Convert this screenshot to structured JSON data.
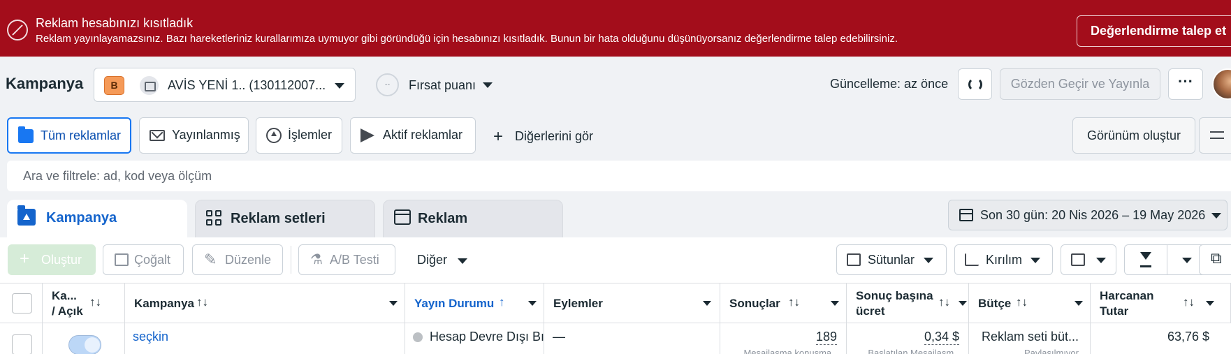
{
  "banner": {
    "title": "Reklam hesabınızı kısıtladık",
    "text": "Reklam yayınlayamazsınız. Bazı hareketleriniz kurallarımıza uymuyor gibi göründüğü için hesabınızı kısıtladık. Bunun bir hata olduğunu düşünüyorsanız değerlendirme talep edebilirsiniz.",
    "button": "Değerlendirme talep et",
    "bg_color": "#a30d1b"
  },
  "topbar": {
    "title": "Kampanya",
    "account_badge": "B",
    "account_name": "AVİS YENİ 1.. (130112007...",
    "opportunity_ring": "--",
    "opportunity_label": "Fırsat puanı",
    "update_text": "Güncelleme: az önce",
    "review_button": "Gözden Geçir ve Yayınla",
    "more_button": "···"
  },
  "filter_tabs": [
    {
      "label": "Tüm reklamlar",
      "icon": "folder-icon",
      "active": true
    },
    {
      "label": "Yayınlanmış",
      "icon": "envelope-icon",
      "active": false
    },
    {
      "label": "İşlemler",
      "icon": "upload-icon",
      "active": false
    },
    {
      "label": "Aktif reklamlar",
      "icon": "send-icon",
      "active": false
    }
  ],
  "see_more": "Diğerlerini gör",
  "create_view": "Görünüm oluştur",
  "search": {
    "placeholder": "Ara ve filtrele: ad, kod veya ölçüm"
  },
  "level_tabs": [
    {
      "label": "Kampanya",
      "active": true
    },
    {
      "label": "Reklam setleri",
      "active": false
    },
    {
      "label": "Reklam",
      "active": false
    }
  ],
  "date_range": "Son 30 gün: 20 Nis 2026 – 19 May 2026",
  "toolbar": {
    "create": "Oluştur",
    "duplicate": "Çoğalt",
    "edit": "Düzenle",
    "ab_test": "A/B Testi",
    "other": "Diğer",
    "columns": "Sütunlar",
    "breakdown": "Kırılım"
  },
  "table": {
    "headers": {
      "onoff_line1": "Ka...",
      "onoff_line2": "/ Açık",
      "campaign": "Kampanya",
      "delivery": "Yayın Durumu",
      "actions": "Eylemler",
      "results": "Sonuçlar",
      "cost_line1": "Sonuç başına",
      "cost_line2": "ücret",
      "budget": "Bütçe",
      "spent_line1": "Harcanan",
      "spent_line2": "Tutar",
      "sort_glyph": "↑↓",
      "sorted_glyph": "↑"
    },
    "rows": [
      {
        "campaign": "seçkin",
        "delivery": "Hesap Devre Dışı Bı",
        "actions": "—",
        "results": "189",
        "results_sub": "Mesajlaşma konuşma...",
        "cost": "0,34 $",
        "cost_sub": "Başlatılan Mesajlaşm...",
        "budget": "Reklam seti büt...",
        "budget_sub": "Paylaşılmıyor",
        "spent": "63,76 $"
      }
    ]
  }
}
